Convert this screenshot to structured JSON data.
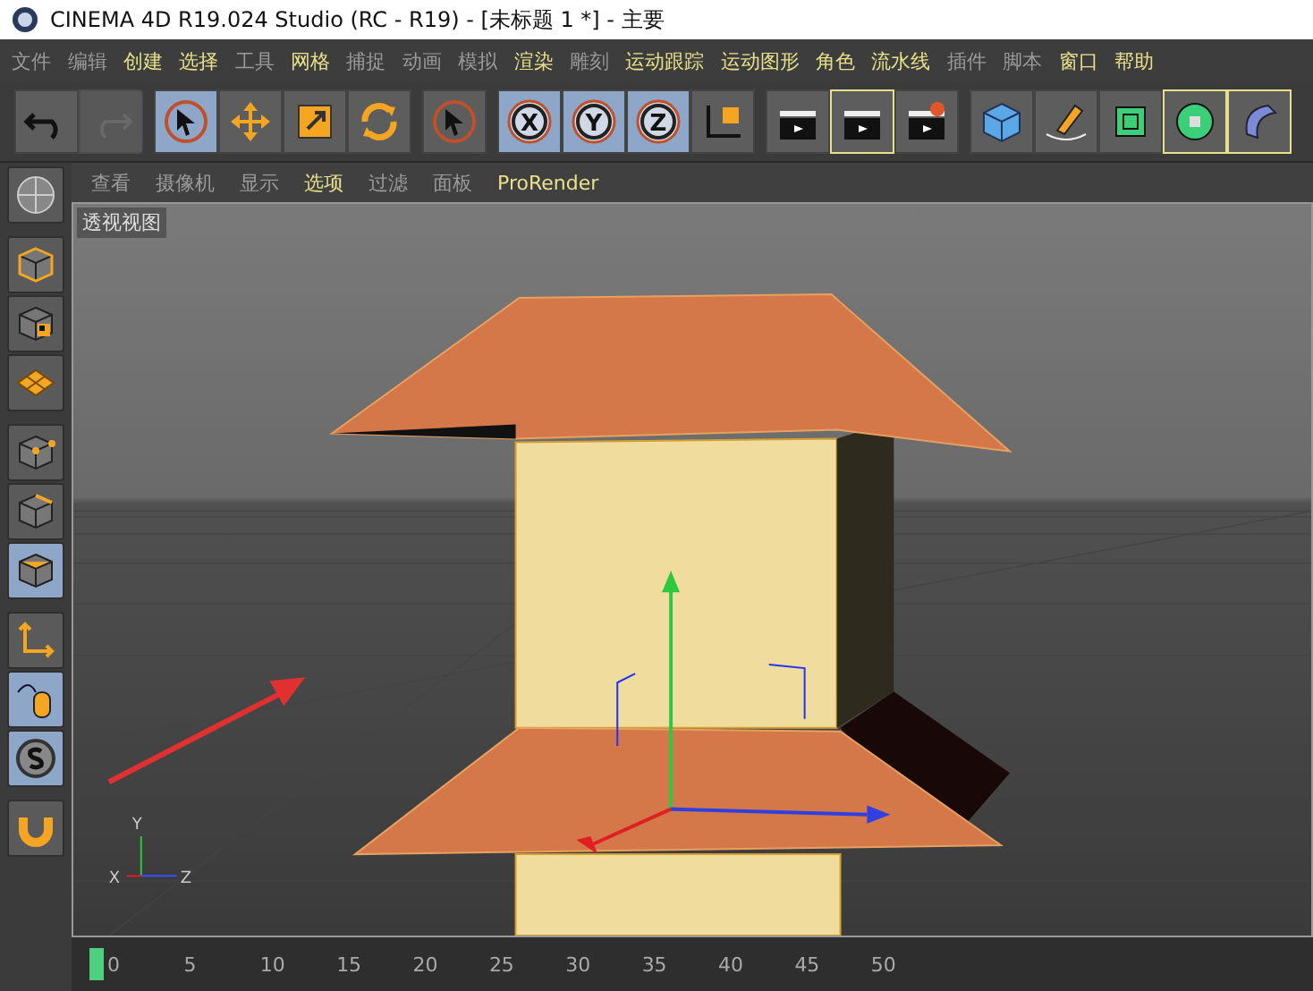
{
  "window": {
    "title": "CINEMA 4D R19.024 Studio (RC - R19) - [未标题 1 *] - 主要"
  },
  "menu": [
    {
      "label": "文件",
      "highlighted": false
    },
    {
      "label": "编辑",
      "highlighted": false
    },
    {
      "label": "创建",
      "highlighted": true
    },
    {
      "label": "选择",
      "highlighted": true
    },
    {
      "label": "工具",
      "highlighted": false
    },
    {
      "label": "网格",
      "highlighted": true
    },
    {
      "label": "捕捉",
      "highlighted": false
    },
    {
      "label": "动画",
      "highlighted": false
    },
    {
      "label": "模拟",
      "highlighted": false
    },
    {
      "label": "渲染",
      "highlighted": true
    },
    {
      "label": "雕刻",
      "highlighted": false
    },
    {
      "label": "运动跟踪",
      "highlighted": true
    },
    {
      "label": "运动图形",
      "highlighted": true
    },
    {
      "label": "角色",
      "highlighted": true
    },
    {
      "label": "流水线",
      "highlighted": true
    },
    {
      "label": "插件",
      "highlighted": false
    },
    {
      "label": "脚本",
      "highlighted": false
    },
    {
      "label": "窗口",
      "highlighted": true
    },
    {
      "label": "帮助",
      "highlighted": true
    }
  ],
  "toolbar": [
    {
      "group": [
        {
          "kind": "undo",
          "selected": false,
          "disabled": false
        },
        {
          "kind": "redo",
          "selected": false,
          "disabled": true
        }
      ]
    },
    {
      "group": [
        {
          "kind": "select",
          "selected": true,
          "disabled": false
        },
        {
          "kind": "move",
          "selected": false,
          "disabled": false
        },
        {
          "kind": "scale",
          "selected": false,
          "disabled": false
        },
        {
          "kind": "rotate",
          "selected": false,
          "disabled": false
        }
      ]
    },
    {
      "group": [
        {
          "kind": "live",
          "selected": false,
          "disabled": false
        }
      ]
    },
    {
      "group": [
        {
          "kind": "axis",
          "label": "X",
          "selected": true,
          "disabled": false
        },
        {
          "kind": "axis",
          "label": "Y",
          "selected": true,
          "disabled": false
        },
        {
          "kind": "axis",
          "label": "Z",
          "selected": true,
          "disabled": false
        },
        {
          "kind": "coord",
          "selected": false,
          "disabled": false
        }
      ]
    },
    {
      "group": [
        {
          "kind": "clap",
          "selected": false,
          "disabled": false
        },
        {
          "kind": "clap",
          "selected": true,
          "disabled": false
        },
        {
          "kind": "clapgear",
          "selected": false,
          "disabled": false
        }
      ]
    },
    {
      "group": [
        {
          "kind": "cube",
          "selected": false,
          "disabled": false
        },
        {
          "kind": "pen",
          "selected": false,
          "disabled": false
        },
        {
          "kind": "subdiv",
          "selected": false,
          "disabled": false
        },
        {
          "kind": "cloner",
          "selected": true,
          "disabled": false
        },
        {
          "kind": "deformer",
          "selected": true,
          "disabled": false
        }
      ]
    }
  ],
  "side_toolbar": [
    {
      "kind": "model",
      "selected": false
    },
    {
      "kind": "texture",
      "selected": false
    },
    {
      "kind": "workplane",
      "selected": false
    },
    {
      "kind": "points",
      "selected": false
    },
    {
      "kind": "edges",
      "selected": false
    },
    {
      "kind": "polygons",
      "selected": true
    },
    {
      "kind": "axis",
      "selected": false
    },
    {
      "kind": "tweak",
      "selected": true
    },
    {
      "kind": "solo",
      "selected": true
    },
    {
      "kind": "magnet",
      "selected": false
    }
  ],
  "viewport": {
    "menu": [
      {
        "label": "查看",
        "highlighted": false
      },
      {
        "label": "摄像机",
        "highlighted": false
      },
      {
        "label": "显示",
        "highlighted": false
      },
      {
        "label": "选项",
        "highlighted": true
      },
      {
        "label": "过滤",
        "highlighted": false
      },
      {
        "label": "面板",
        "highlighted": false
      },
      {
        "label": "ProRender",
        "highlighted": true
      }
    ],
    "view_name": "透视视图",
    "axis_labels": [
      "Y",
      "X",
      "Z"
    ]
  },
  "timeline": {
    "ticks": [
      "0",
      "5",
      "10",
      "15",
      "20",
      "25",
      "30",
      "35",
      "40",
      "45",
      "50"
    ]
  }
}
